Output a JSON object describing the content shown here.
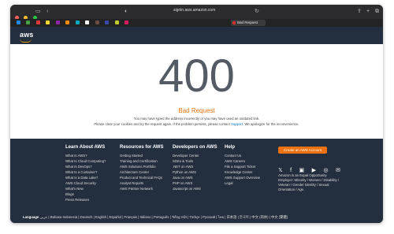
{
  "browser": {
    "url": "signin.aws.amazon.com",
    "tab_title": "Bad Request"
  },
  "header": {
    "logo_text": "aws"
  },
  "error": {
    "code": "400",
    "reason": "Bad Request",
    "message1": "You may have typed the address incorrectly or you may have used an outdated link.",
    "message2_before": "Please clear your cookies and try the request again. If the problem persists, please contact",
    "support_link": "Support",
    "message2_after": ". We apologize for the inconvenience."
  },
  "footer": {
    "columns": [
      {
        "title": "Learn About AWS",
        "links": [
          "What Is AWS?",
          "What Is Cloud Computing?",
          "What Is DevOps?",
          "What Is a Container?",
          "What Is a Data Lake?",
          "AWS Cloud Security",
          "What's New",
          "Blogs",
          "Press Releases"
        ]
      },
      {
        "title": "Resources for AWS",
        "links": [
          "Getting Started",
          "Training and Certification",
          "AWS Solutions Portfolio",
          "Architecture Center",
          "Product and Technical FAQs",
          "Analyst Reports",
          "AWS Partner Network"
        ]
      },
      {
        "title": "Developers on AWS",
        "links": [
          "Developer Center",
          "SDKs & Tools",
          ".NET on AWS",
          "Python on AWS",
          "Java on AWS",
          "PHP on AWS",
          "Javascript on AWS"
        ]
      },
      {
        "title": "Help",
        "links": [
          "Contact Us",
          "AWS Careers",
          "File a Support Ticket",
          "Knowledge Center",
          "AWS Support Overview",
          "Legal"
        ]
      }
    ],
    "cta": "Create an AWS Account",
    "eeo": "Amazon is an Equal Opportunity Employer: Minority / Women / Disability / Veteran / Gender Identity / Sexual Orientation / Age.",
    "language_label": "Language",
    "languages": "عربي | Bahasa Indonesia | Deutsch | English | Español | Français | Italiano | Português | Tiếng Việt | Türkçe | Ρусский | ไทย | 日本語 | 한국어 | 中文 (简体) | 中文 (繁體)"
  },
  "colors": {
    "accent": "#ec7211",
    "footer_bg": "#232f3e",
    "link": "#0073bb"
  },
  "icons": [
    "twitter-icon",
    "facebook-icon",
    "twitch-icon",
    "youtube-icon",
    "podcast-icon",
    "email-icon"
  ]
}
